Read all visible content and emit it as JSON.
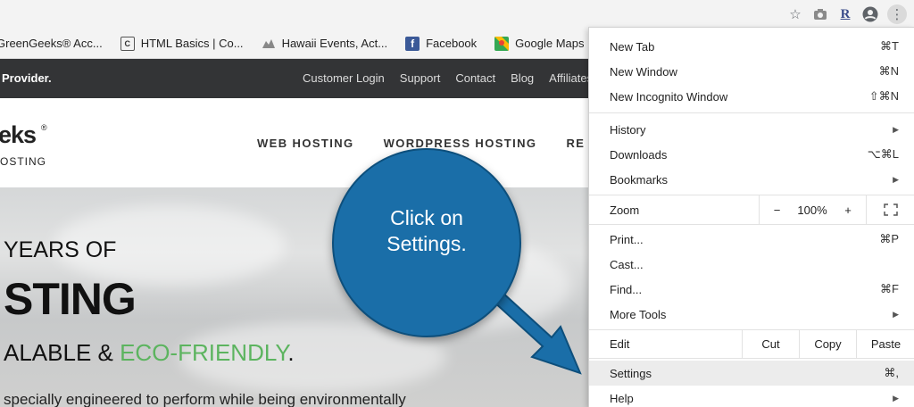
{
  "chrome": {
    "icons": [
      "star-icon",
      "camera-icon",
      "r-extension-icon",
      "account-icon",
      "more-icon"
    ]
  },
  "bookmarks": [
    {
      "label": "GreenGeeks® Acc...",
      "icon": "greengeeks-icon"
    },
    {
      "label": "HTML Basics | Co...",
      "icon": "c-icon"
    },
    {
      "label": "Hawaii Events, Act...",
      "icon": "hawaii-icon"
    },
    {
      "label": "Facebook",
      "icon": "facebook-icon"
    },
    {
      "label": "Google Maps",
      "icon": "maps-icon"
    }
  ],
  "site": {
    "provider_text": "Provider.",
    "top_links": [
      "Customer Login",
      "Support",
      "Contact",
      "Blog",
      "Affiliates"
    ],
    "logo_text": "eks",
    "logo_sub": "OSTING",
    "main_nav": [
      "WEB HOSTING",
      "WORDPRESS HOSTING",
      "RE"
    ],
    "hero": {
      "line1": "YEARS OF",
      "line2": "STING",
      "line3_a": "ALABLE & ",
      "line3_b": "ECO-FRIENDLY",
      "line3_c": ".",
      "line4": "specially engineered to perform while being environmentally"
    }
  },
  "callout": {
    "text_line1": "Click on",
    "text_line2": "Settings."
  },
  "menu": {
    "new_tab": {
      "label": "New Tab",
      "shortcut": "⌘T"
    },
    "new_window": {
      "label": "New Window",
      "shortcut": "⌘N"
    },
    "incognito": {
      "label": "New Incognito Window",
      "shortcut": "⇧⌘N"
    },
    "history": {
      "label": "History"
    },
    "downloads": {
      "label": "Downloads",
      "shortcut": "⌥⌘L"
    },
    "bookmarks": {
      "label": "Bookmarks"
    },
    "zoom": {
      "label": "Zoom",
      "minus": "−",
      "value": "100%",
      "plus": "+"
    },
    "print": {
      "label": "Print...",
      "shortcut": "⌘P"
    },
    "cast": {
      "label": "Cast..."
    },
    "find": {
      "label": "Find...",
      "shortcut": "⌘F"
    },
    "more_tools": {
      "label": "More Tools"
    },
    "edit": {
      "label": "Edit",
      "cut": "Cut",
      "copy": "Copy",
      "paste": "Paste"
    },
    "settings": {
      "label": "Settings",
      "shortcut": "⌘,"
    },
    "help": {
      "label": "Help"
    }
  },
  "colors": {
    "callout": "#1a6ea8",
    "eco_green": "#5cb45f",
    "topbar": "#333436"
  }
}
